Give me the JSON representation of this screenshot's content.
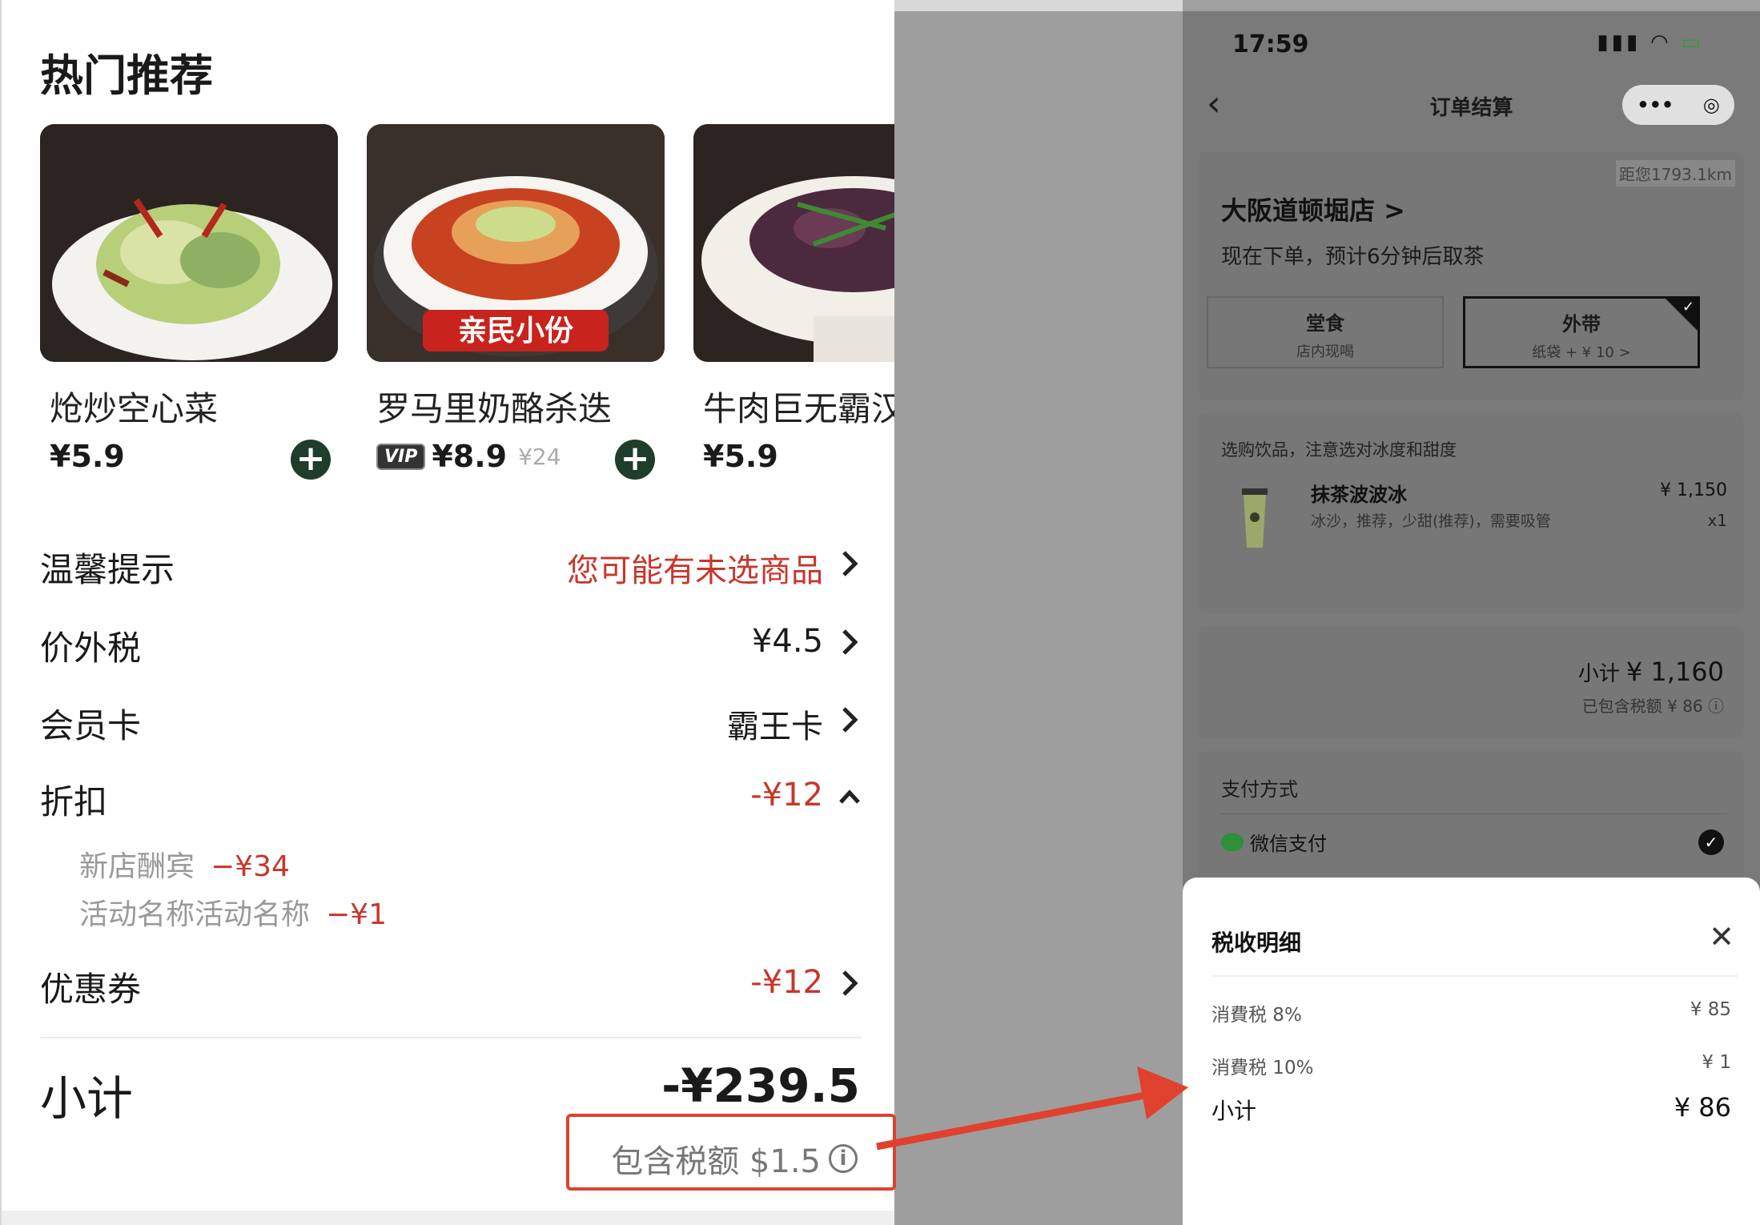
{
  "left": {
    "section_title": "热门推荐",
    "products": [
      {
        "name": "炝炒空心菜",
        "price": "¥5.9"
      },
      {
        "name": "罗马里奶酪杀迭",
        "vip_badge": "VIP",
        "price": "¥8.9",
        "orig_price": "¥24",
        "photo_banner": "亲民小份"
      },
      {
        "name": "牛肉巨无霸汉",
        "price": "¥5.9"
      }
    ],
    "rows": {
      "tip_label": "温馨提示",
      "tip_value": "您可能有未选商品",
      "tax_label": "价外税",
      "tax_value": "¥4.5",
      "member_label": "会员卡",
      "member_value": "霸王卡",
      "discount_label": "折扣",
      "discount_value": "-¥12",
      "discount_items": [
        {
          "name": "新店酬宾",
          "amount": "−¥34"
        },
        {
          "name": "活动名称活动名称",
          "amount": "−¥1"
        }
      ],
      "coupon_label": "优惠券",
      "coupon_value": "-¥12"
    },
    "subtotal_label": "小计",
    "subtotal_value": "-¥239.5",
    "tax_included": "包含税额 $1.5",
    "info_glyph": "i"
  },
  "phone": {
    "status_time": "17:59",
    "nav_title": "订单结算",
    "capsule_more": "•••",
    "capsule_target": "◎",
    "store_name": "大阪道顿堀店 >",
    "distance": "距您1793.1km",
    "pickup_text": "现在下单，预计6分钟后取茶",
    "dine_in": {
      "title": "堂食",
      "sub": "店内现喝"
    },
    "takeaway": {
      "title": "外带",
      "sub": "纸袋 + ¥ 10 >"
    },
    "drink_note": "选购饮品，注意选对冰度和甜度",
    "drink": {
      "name": "抹茶波波冰",
      "desc": "冰沙，推荐，少甜(推荐)，需要吸管",
      "price": "¥ 1,150",
      "qty": "x1"
    },
    "subtotal_label": "小计",
    "subtotal_value": "¥ 1,160",
    "tax_included": "已包含税额 ¥ 86 ⓘ",
    "pay_title": "支付方式",
    "wechat_pay": "微信支付",
    "sheet": {
      "title": "税收明细",
      "close": "✕",
      "rows": [
        {
          "label": "消費税 8%",
          "value": "¥ 85"
        },
        {
          "label": "消費税 10%",
          "value": "¥ 1"
        }
      ],
      "total_label": "小计",
      "total_value": "¥ 86"
    }
  },
  "colors": {
    "accent_red": "#c8362b",
    "highlight": "#e0412e",
    "add_button": "#1e3d2a"
  }
}
